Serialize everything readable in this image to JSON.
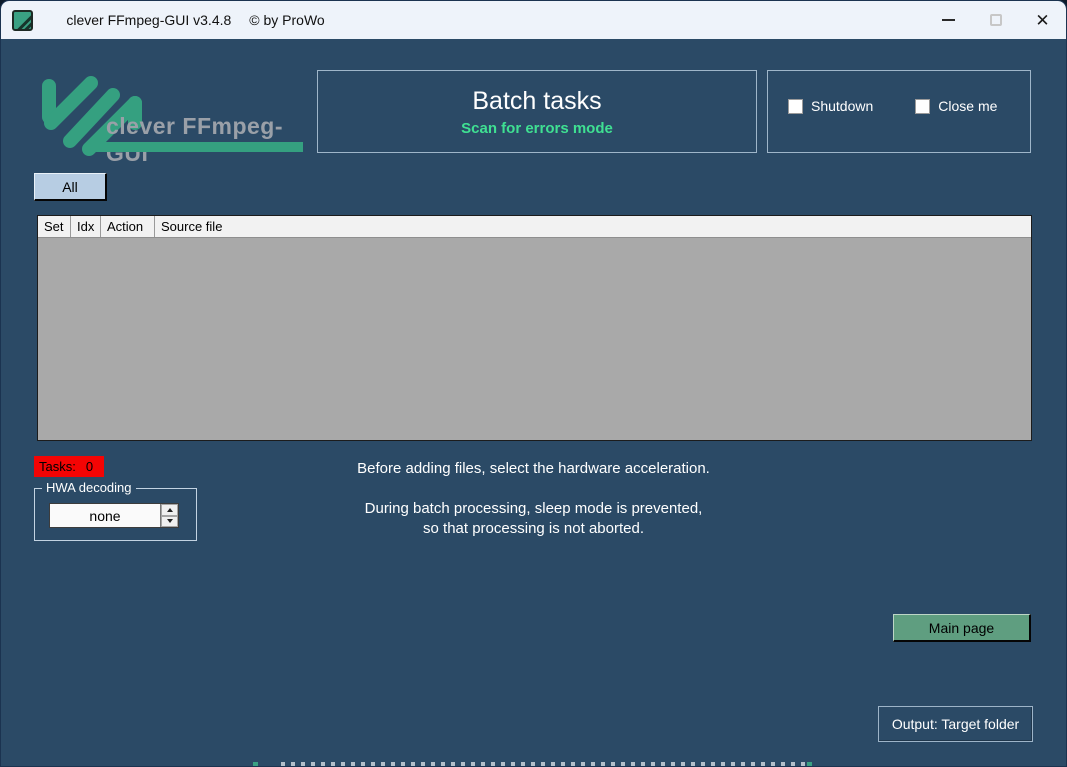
{
  "window": {
    "title": "clever FFmpeg-GUI v3.4.8",
    "copyright": "© by ProWo",
    "controls": {
      "minimize": "minimize",
      "maximize": "maximize (disabled)",
      "close": "✕"
    }
  },
  "branding": {
    "logo_text": "clever FFmpeg-GUI"
  },
  "header": {
    "title": "Batch tasks",
    "subtitle": "Scan for errors mode"
  },
  "options": {
    "shutdown_label": "Shutdown",
    "shutdown_checked": false,
    "closeme_label": "Close me",
    "closeme_checked": false
  },
  "toolbar": {
    "all_label": "All"
  },
  "table": {
    "columns": [
      "Set",
      "Idx",
      "Action",
      "Source file"
    ],
    "rows": []
  },
  "status": {
    "tasks_label": "Tasks:",
    "tasks_count": "0"
  },
  "hwa": {
    "group_label": "HWA decoding",
    "value": "none"
  },
  "info": {
    "line1": "Before adding files, select the hardware acceleration.",
    "line2": "During batch processing, sleep mode is prevented,",
    "line3": "so that processing is not aborted."
  },
  "buttons": {
    "main_page": "Main page",
    "output": "Output: Target folder"
  },
  "colors": {
    "window_background": "#2b4a66",
    "titlebar_background": "#eef3fa",
    "logo_green": "#35a080",
    "subtitle_green": "#3fe092",
    "tasks_badge_red": "#f40404",
    "all_button_blue": "#b7cde3",
    "main_page_green": "#5f9e80",
    "table_body_gray": "#a9a9a9",
    "table_header_gray": "#f2f2f2",
    "frame_border": "#9fb6c9"
  }
}
